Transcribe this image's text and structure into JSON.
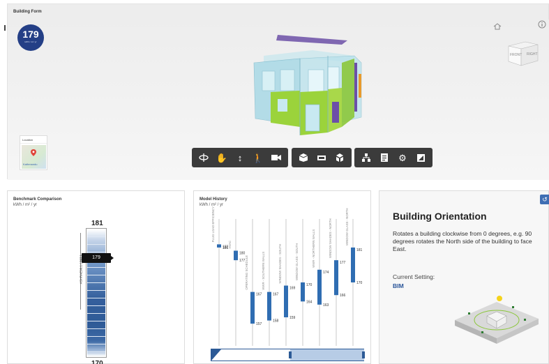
{
  "building_form": {
    "title": "Building Form",
    "score": "179",
    "score_unit": "kWh / m² / yr",
    "location_label": "Location",
    "map_label": "Kathmandu",
    "navcube_front": "FRONT",
    "navcube_right": "RIGHT"
  },
  "toolbar_groups": [
    [
      "orbit-icon",
      "pan-icon",
      "zoom-icon",
      "walk-icon",
      "camera-icon"
    ],
    [
      "box-icon",
      "section-icon",
      "explode-icon"
    ],
    [
      "model-tree-icon",
      "properties-icon",
      "settings-icon",
      "fullscreen-icon"
    ]
  ],
  "benchmark": {
    "title": "Benchmark Comparison",
    "units": "kWh / m² / yr",
    "top_value": "181",
    "bottom_value": "170",
    "axis_label": "ASHRAE90.1 ( 397 )",
    "marker_value": "179"
  },
  "history": {
    "title": "Model History",
    "units": "kWh / m² / yr"
  },
  "chart_data": {
    "type": "bar",
    "title": "Model History",
    "ylabel": "kWh / m² / yr",
    "categories": [
      "PLUG LOAD EFFICIENCY",
      "HVAC",
      "OPERATING SCHEDULE",
      "WWR - SOUTHERN WALLS",
      "WINDOW SHADES - SOUTH",
      "WINDOW GLASS - SOUTH",
      "WWR - NORTHERN WALLS",
      "WINDOW SHADES - NORTH",
      "WINDOW GLASS - NORTH"
    ],
    "series": [
      {
        "values": [
          [
            181,
            182
          ],
          [
            177,
            180
          ],
          [
            157,
            167
          ],
          [
            158,
            167
          ],
          [
            159,
            169
          ],
          [
            164,
            170
          ],
          [
            163,
            174
          ],
          [
            166,
            177
          ],
          [
            170,
            181
          ]
        ]
      }
    ],
    "value_labels": [
      [
        "182",
        "181"
      ],
      [
        "180",
        "177"
      ],
      [
        "167",
        "157"
      ],
      [
        "167",
        "158"
      ],
      [
        "169",
        "159"
      ],
      [
        "170",
        "164"
      ],
      [
        "174",
        "163"
      ],
      [
        "177",
        "166"
      ],
      [
        "181",
        "170"
      ]
    ],
    "ylim": [
      150,
      190
    ],
    "colors": {
      "bar": "#2f6db2"
    }
  },
  "orientation": {
    "title": "Building Orientation",
    "description": "Rotates a building clockwise from 0 degrees, e.g. 90 degrees rotates the North side of the building to face East.",
    "current_label": "Current Setting:",
    "current_value": "BIM"
  }
}
